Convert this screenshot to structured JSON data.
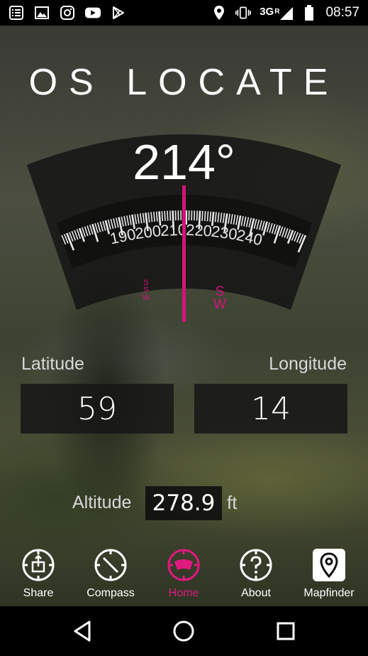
{
  "status_bar": {
    "left_icons": [
      "notes-icon",
      "image-icon",
      "instagram-icon",
      "youtube-icon",
      "play-store-icon"
    ],
    "right_icons": [
      "location-icon",
      "vibrate-icon",
      "signal-icon",
      "battery-icon"
    ],
    "network": "3G",
    "roaming": "R",
    "time": "08:57"
  },
  "app": {
    "title": "OS LOCATE"
  },
  "compass": {
    "heading": "214°",
    "heading_value": 214,
    "scale_labels": [
      "190",
      "200",
      "210",
      "220",
      "230",
      "240"
    ],
    "markers": [
      "SSW",
      "SW"
    ],
    "needle_color": "#d6137a"
  },
  "location": {
    "latitude_label": "Latitude",
    "latitude_value": "59",
    "longitude_label": "Longitude",
    "longitude_value": "14",
    "altitude_label": "Altitude",
    "altitude_value": "278.9",
    "altitude_unit": "ft"
  },
  "tabs": [
    {
      "label": "Share",
      "icon": "share-icon",
      "active": false
    },
    {
      "label": "Compass",
      "icon": "compass-icon",
      "active": false
    },
    {
      "label": "Home",
      "icon": "home-compass-icon",
      "active": true
    },
    {
      "label": "About",
      "icon": "help-icon",
      "active": false
    },
    {
      "label": "Mapfinder",
      "icon": "map-pin-icon",
      "active": false
    }
  ],
  "accent_color": "#e0197f",
  "nav_bar": [
    "back-icon",
    "home-icon",
    "recents-icon"
  ]
}
